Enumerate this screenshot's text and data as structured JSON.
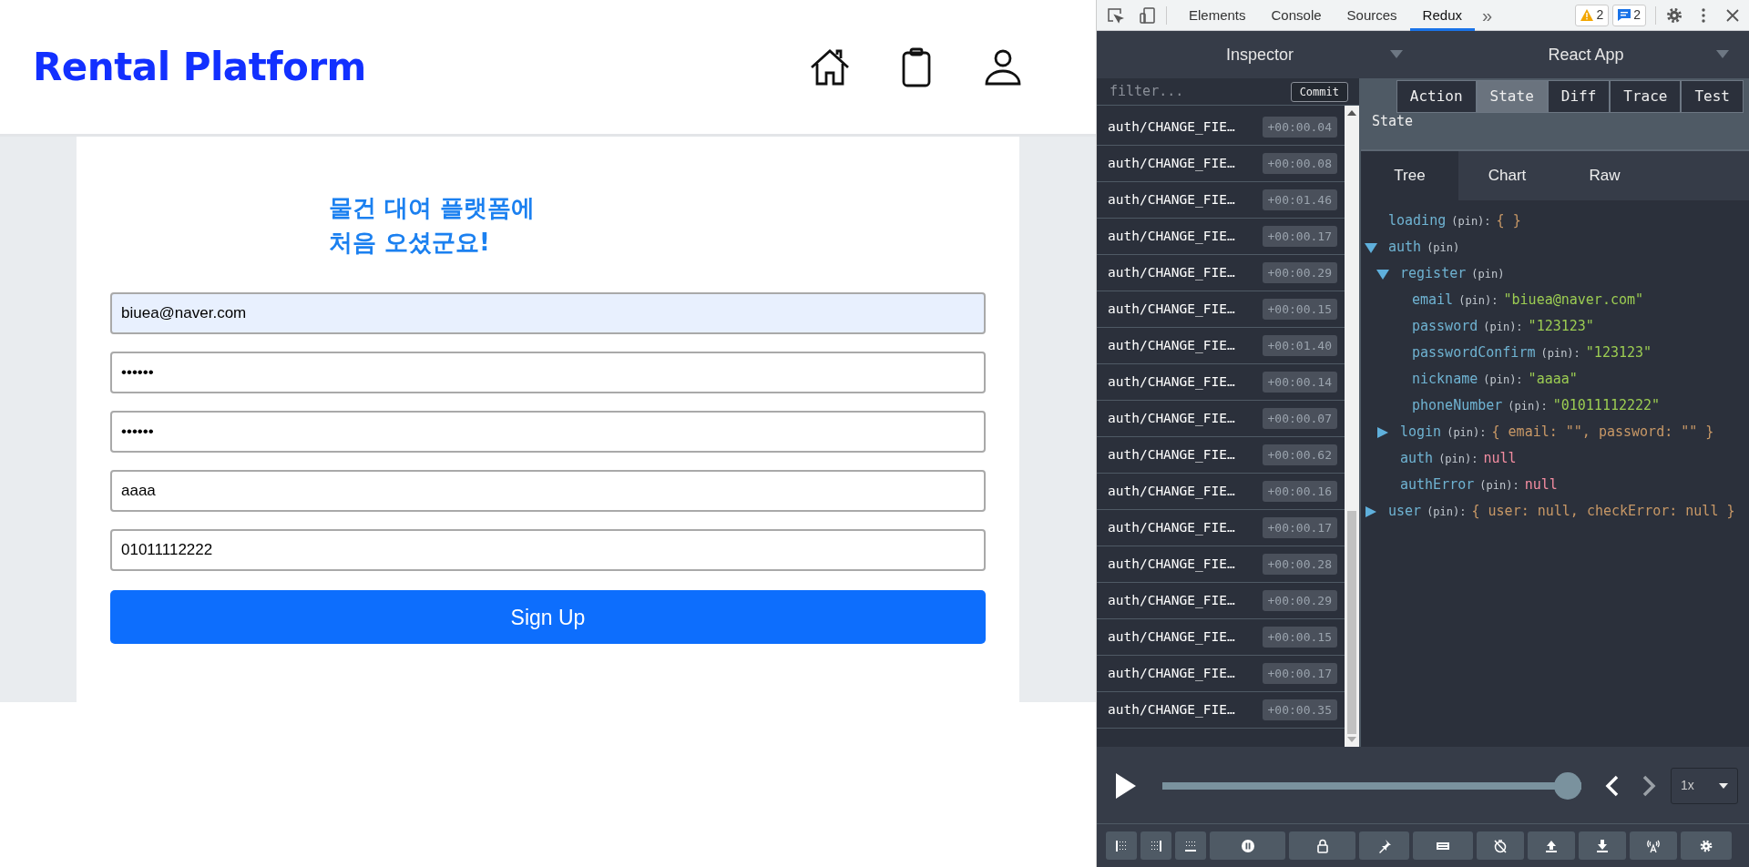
{
  "page": {
    "brand": "Rental Platform",
    "heading_lines": [
      "물건 대여 플랫폼에",
      "처음 오셨군요!"
    ],
    "fields": [
      {
        "value": "biuea@naver.com",
        "autofilled": true
      },
      {
        "value": "••••••",
        "autofilled": false
      },
      {
        "value": "••••••",
        "autofilled": false
      },
      {
        "value": "aaaa",
        "autofilled": false
      },
      {
        "value": "01011112222",
        "autofilled": false
      }
    ],
    "submit": "Sign Up"
  },
  "devtools": {
    "tabs": [
      {
        "label": "Elements",
        "selected": false
      },
      {
        "label": "Console",
        "selected": false
      },
      {
        "label": "Sources",
        "selected": false
      },
      {
        "label": "Redux",
        "selected": true
      }
    ],
    "more": "»",
    "warnings": "2",
    "messages": "2",
    "selectors": [
      "Inspector",
      "React App"
    ],
    "filter_placeholder": "filter...",
    "commit": "Commit",
    "actions": [
      {
        "name": "auth/CHANGE_FIE…",
        "time": "+00:00.04"
      },
      {
        "name": "auth/CHANGE_FIE…",
        "time": "+00:00.08"
      },
      {
        "name": "auth/CHANGE_FIE…",
        "time": "+00:01.46"
      },
      {
        "name": "auth/CHANGE_FIE…",
        "time": "+00:00.17"
      },
      {
        "name": "auth/CHANGE_FIE…",
        "time": "+00:00.29"
      },
      {
        "name": "auth/CHANGE_FIE…",
        "time": "+00:00.15"
      },
      {
        "name": "auth/CHANGE_FIE…",
        "time": "+00:01.40"
      },
      {
        "name": "auth/CHANGE_FIE…",
        "time": "+00:00.14"
      },
      {
        "name": "auth/CHANGE_FIE…",
        "time": "+00:00.07"
      },
      {
        "name": "auth/CHANGE_FIE…",
        "time": "+00:00.62"
      },
      {
        "name": "auth/CHANGE_FIE…",
        "time": "+00:00.16"
      },
      {
        "name": "auth/CHANGE_FIE…",
        "time": "+00:00.17"
      },
      {
        "name": "auth/CHANGE_FIE…",
        "time": "+00:00.28"
      },
      {
        "name": "auth/CHANGE_FIE…",
        "time": "+00:00.29"
      },
      {
        "name": "auth/CHANGE_FIE…",
        "time": "+00:00.15"
      },
      {
        "name": "auth/CHANGE_FIE…",
        "time": "+00:00.17"
      },
      {
        "name": "auth/CHANGE_FIE…",
        "time": "+00:00.35"
      }
    ],
    "monitor_tabs": [
      {
        "label": "Action",
        "selected": false
      },
      {
        "label": "State",
        "selected": true
      },
      {
        "label": "Diff",
        "selected": false
      },
      {
        "label": "Trace",
        "selected": false
      },
      {
        "label": "Test",
        "selected": false
      }
    ],
    "panel_title": "State",
    "view_tabs": [
      {
        "label": "Tree",
        "selected": true
      },
      {
        "label": "Chart",
        "selected": false
      },
      {
        "label": "Raw",
        "selected": false
      }
    ],
    "tree": [
      {
        "kind": "leaf",
        "key": "loading",
        "pin": "(pin):",
        "value": "{ }",
        "color": "#c89866"
      },
      {
        "kind": "open",
        "key": "auth",
        "pin": "(pin)",
        "children": [
          {
            "kind": "open",
            "key": "register",
            "pin": "(pin)",
            "children": [
              {
                "kind": "leaf",
                "key": "email",
                "pin": "(pin):",
                "value": "\"biuea@naver.com\"",
                "color": "#9ccc52"
              },
              {
                "kind": "leaf",
                "key": "password",
                "pin": "(pin):",
                "value": "\"123123\"",
                "color": "#9ccc52"
              },
              {
                "kind": "leaf",
                "key": "passwordConfirm",
                "pin": "(pin):",
                "value": "\"123123\"",
                "color": "#9ccc52"
              },
              {
                "kind": "leaf",
                "key": "nickname",
                "pin": "(pin):",
                "value": "\"aaaa\"",
                "color": "#9ccc52"
              },
              {
                "kind": "leaf",
                "key": "phoneNumber",
                "pin": "(pin):",
                "value": "\"01011112222\"",
                "color": "#9ccc52"
              }
            ]
          },
          {
            "kind": "closed",
            "key": "login",
            "pin": "(pin):",
            "value": "{ email: \"\", password: \"\" }",
            "color": "#c89866"
          },
          {
            "kind": "leaf",
            "key": "auth",
            "pin": "(pin):",
            "value": "null",
            "color": "#f28ca0"
          },
          {
            "kind": "leaf",
            "key": "authError",
            "pin": "(pin):",
            "value": "null",
            "color": "#f28ca0"
          }
        ]
      },
      {
        "kind": "closed",
        "key": "user",
        "pin": "(pin):",
        "value": "{ user: null, checkError: null }",
        "color": "#c89866"
      }
    ],
    "slider": {
      "level": 1
    },
    "speed": "1x"
  }
}
